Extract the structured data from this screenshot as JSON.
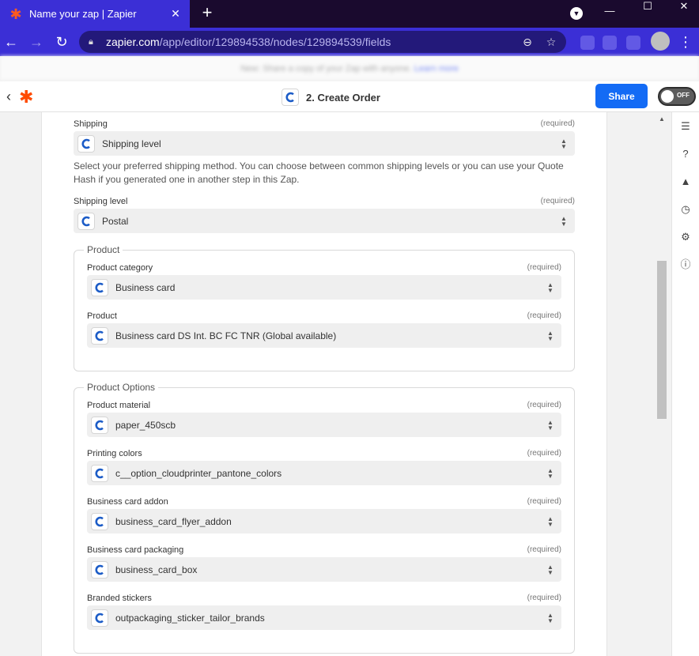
{
  "browser": {
    "tab_title": "Name your zap | Zapier",
    "url_host": "zapier.com",
    "url_path": "/app/editor/129894538/nodes/129894539/fields"
  },
  "banner": {
    "text": "New: Share a copy of your Zap with anyone.",
    "link": "Learn more"
  },
  "header": {
    "step_title": "2. Create Order",
    "share_label": "Share",
    "toggle_label": "OFF"
  },
  "required_label": "(required)",
  "shipping": {
    "label": "Shipping",
    "value": "Shipping level",
    "help": "Select your preferred shipping method. You can choose between common shipping levels or you can use your Quote Hash if you generated one in another step in this Zap."
  },
  "shipping_level": {
    "label": "Shipping level",
    "value": "Postal"
  },
  "product_group": {
    "legend": "Product",
    "fields": [
      {
        "label": "Product category",
        "value": "Business card"
      },
      {
        "label": "Product",
        "value": "Business card DS Int. BC FC TNR (Global available)"
      }
    ]
  },
  "options_group": {
    "legend": "Product Options",
    "fields": [
      {
        "label": "Product material",
        "value": "paper_450scb"
      },
      {
        "label": "Printing colors",
        "value": "c__option_cloudprinter_pantone_colors"
      },
      {
        "label": "Business card addon",
        "value": "business_card_flyer_addon"
      },
      {
        "label": "Business card packaging",
        "value": "business_card_box"
      },
      {
        "label": "Branded stickers",
        "value": "outpackaging_sticker_tailor_brands"
      }
    ]
  }
}
